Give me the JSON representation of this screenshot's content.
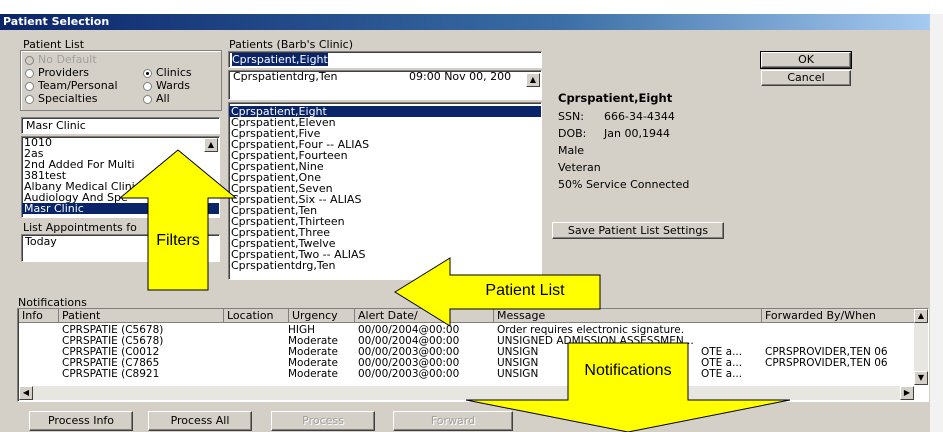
{
  "window": {
    "title": "Patient Selection"
  },
  "patient_list": {
    "label": "Patient List",
    "radios": [
      {
        "label": "No Default",
        "selected": false,
        "disabled": true
      },
      {
        "label": "Providers",
        "selected": false
      },
      {
        "label": "Clinics",
        "selected": true
      },
      {
        "label": "Team/Personal",
        "selected": false
      },
      {
        "label": "Wards",
        "selected": false
      },
      {
        "label": "Specialties",
        "selected": false
      },
      {
        "label": "All",
        "selected": false
      }
    ],
    "search_value": "Masr Clinic",
    "items": [
      "1010",
      "2as",
      "2nd Added For Multi",
      "381test",
      "Albany Medical Clini",
      "Audiology And Spe",
      "Masr Clinic"
    ],
    "selected_item": "Masr Clinic",
    "appointments_label": "List Appointments fo",
    "appointments_value": "Today"
  },
  "patients": {
    "label": "Patients (Barb's Clinic)",
    "search_value": "Cprspatient,Eight",
    "appointment": {
      "name": "Cprspatientdrg,Ten",
      "time": "09:00 Nov 00, 200"
    },
    "items": [
      "Cprspatient,Eight",
      "Cprspatient,Eleven",
      "Cprspatient,Five",
      "Cprspatient,Four -- ALIAS",
      "Cprspatient,Fourteen",
      "Cprspatient,Nine",
      "Cprspatient,One",
      "Cprspatient,Seven",
      "Cprspatient,Six -- ALIAS",
      "Cprspatient,Ten",
      "Cprspatient,Thirteen",
      "Cprspatient,Three",
      "Cprspatient,Twelve",
      "Cprspatient,Two -- ALIAS",
      "Cprspatientdrg,Ten"
    ]
  },
  "details": {
    "name": "Cprspatient,Eight",
    "ssn_label": "SSN:",
    "ssn": "666-34-4344",
    "dob_label": "DOB:",
    "dob": "Jan 00,1944",
    "sex": "Male",
    "status": "Veteran",
    "service": "50% Service Connected"
  },
  "buttons": {
    "ok": "OK",
    "cancel": "Cancel",
    "save_settings": "Save Patient List Settings"
  },
  "notifications": {
    "label": "Notifications",
    "columns": [
      "Info",
      "Patient",
      "Location",
      "Urgency",
      "Alert Date/",
      "Message",
      "Forwarded By/When"
    ],
    "rows": [
      {
        "patient": "CPRSPATIE (C5678)",
        "location": "",
        "urgency": "HIGH",
        "date": "00/00/2004@00:00",
        "message": "Order requires electronic signature.",
        "forwarded": ""
      },
      {
        "patient": "CPRSPATIE (C5678)",
        "location": "",
        "urgency": "Moderate",
        "date": "00/00/2004@00:00",
        "message": "UNSIGNED ADMISSION ASSESSMEN...",
        "forwarded": ""
      },
      {
        "patient": "CPRSPATIE (C0012",
        "location": "",
        "urgency": "Moderate",
        "date": "00/00/2003@00:00",
        "message": "UNSIGN",
        "message_tail": "OTE a...",
        "forwarded": "CPRSPROVIDER,TEN  06"
      },
      {
        "patient": "CPRSPATIE (C7865",
        "location": "",
        "urgency": "Moderate",
        "date": "00/00/2003@00:00",
        "message": "UNSIGN",
        "message_tail": "OTE a...",
        "forwarded": "CPRSPROVIDER,TEN  06"
      },
      {
        "patient": "CPRSPATIE (C8921",
        "location": "",
        "urgency": "Moderate",
        "date": "00/00/2003@00:00",
        "message": "UNSIGN",
        "message_tail": "OTE a...",
        "forwarded": ""
      }
    ],
    "buttons": {
      "process_info": "Process Info",
      "process_all": "Process All",
      "process": "Process",
      "forward": "Forward"
    }
  },
  "callouts": {
    "filters": "Filters",
    "patient_list": "Patient List",
    "notifications": "Notifications"
  },
  "colors": {
    "callout": "#ffff00",
    "title_bar": "#0a246a",
    "selection": "#0a246a",
    "window": "#d4d0c8"
  }
}
